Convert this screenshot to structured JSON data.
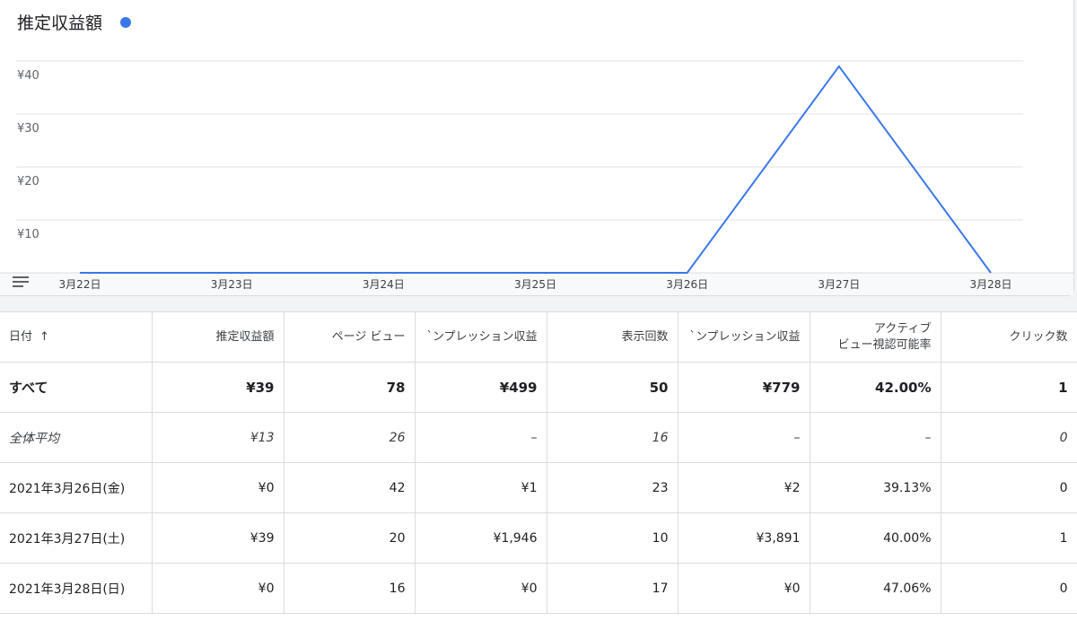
{
  "chart_data": {
    "type": "line",
    "title": "推定収益額",
    "categories": [
      "3月22日",
      "3月23日",
      "3月24日",
      "3月25日",
      "3月26日",
      "3月27日",
      "3月28日"
    ],
    "series": [
      {
        "values": [
          0,
          0,
          0,
          0,
          0,
          39,
          0
        ],
        "color": "#3b78e7"
      }
    ],
    "ylim": [
      0,
      40
    ],
    "yticks": [
      10,
      20,
      30,
      40
    ],
    "ytick_prefix": "¥",
    "grid": true
  },
  "table": {
    "headers": [
      "日付",
      "推定収益額",
      "ページ ビュー",
      "`ンプレッション収益",
      "表示回数",
      "`ンプレッション収益",
      "アクティブ|ビュー視認可能率",
      "クリック数"
    ],
    "sort_arrow": "↑",
    "rows": [
      {
        "kind": "total",
        "cells": [
          "すべて",
          "¥39",
          "78",
          "¥499",
          "50",
          "¥779",
          "42.00%",
          "1"
        ]
      },
      {
        "kind": "avg",
        "cells": [
          "全体平均",
          "¥13",
          "26",
          "–",
          "16",
          "–",
          "–",
          "0"
        ]
      },
      {
        "kind": "row",
        "cells": [
          "2021年3月26日(金)",
          "¥0",
          "42",
          "¥1",
          "23",
          "¥2",
          "39.13%",
          "0"
        ]
      },
      {
        "kind": "row",
        "cells": [
          "2021年3月27日(土)",
          "¥39",
          "20",
          "¥1,946",
          "10",
          "¥3,891",
          "40.00%",
          "1"
        ]
      },
      {
        "kind": "row",
        "cells": [
          "2021年3月28日(日)",
          "¥0",
          "16",
          "¥0",
          "17",
          "¥0",
          "47.06%",
          "0"
        ]
      }
    ]
  }
}
